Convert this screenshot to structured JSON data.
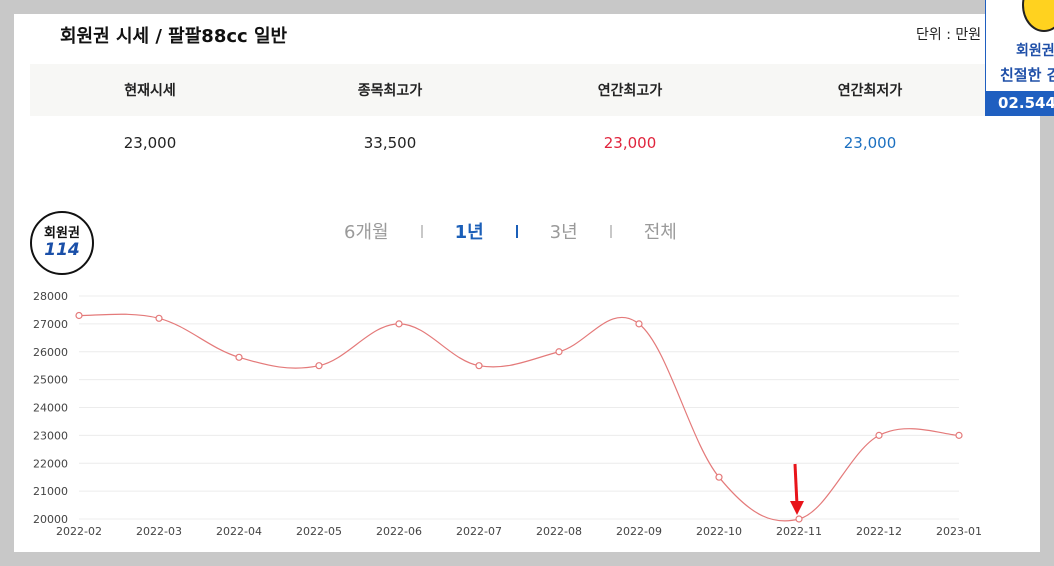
{
  "title": "회원권 시세 / 팔팔88cc 일반",
  "unit_label": "단위 : 만원",
  "summary": {
    "headers": [
      "현재시세",
      "종목최고가",
      "연간최고가",
      "연간최저가"
    ],
    "values": [
      "23,000",
      "33,500",
      "23,000",
      "23,000"
    ],
    "value_colors": [
      "#222222",
      "#222222",
      "#e0243c",
      "#1a6fc0"
    ]
  },
  "badge": {
    "line1": "회원권",
    "line2": "114"
  },
  "tabs": [
    {
      "label": "6개월",
      "active": false
    },
    {
      "label": "1년",
      "active": true
    },
    {
      "label": "3년",
      "active": false
    },
    {
      "label": "전체",
      "active": false
    }
  ],
  "ad": {
    "line1": "회원권",
    "line2": "친절한 김",
    "bar_text": "02.544"
  },
  "colors": {
    "line": "#e47a7a",
    "marker": "#e47a7a",
    "arrow": "#e8141a",
    "active_tab": "#1b5fb8"
  },
  "chart_data": {
    "type": "line",
    "categories": [
      "2022-02",
      "2022-03",
      "2022-04",
      "2022-05",
      "2022-06",
      "2022-07",
      "2022-08",
      "2022-09",
      "2022-10",
      "2022-11",
      "2022-12",
      "2023-01"
    ],
    "values": [
      27300,
      27200,
      25800,
      25500,
      27000,
      25500,
      26000,
      27000,
      21500,
      20000,
      23000,
      23000
    ],
    "ylim": [
      20000,
      28000
    ],
    "yticks": [
      20000,
      21000,
      22000,
      23000,
      24000,
      25000,
      26000,
      27000,
      28000
    ],
    "grid": true,
    "smooth": true,
    "annotation": {
      "type": "arrow",
      "category": "2022-11"
    }
  }
}
